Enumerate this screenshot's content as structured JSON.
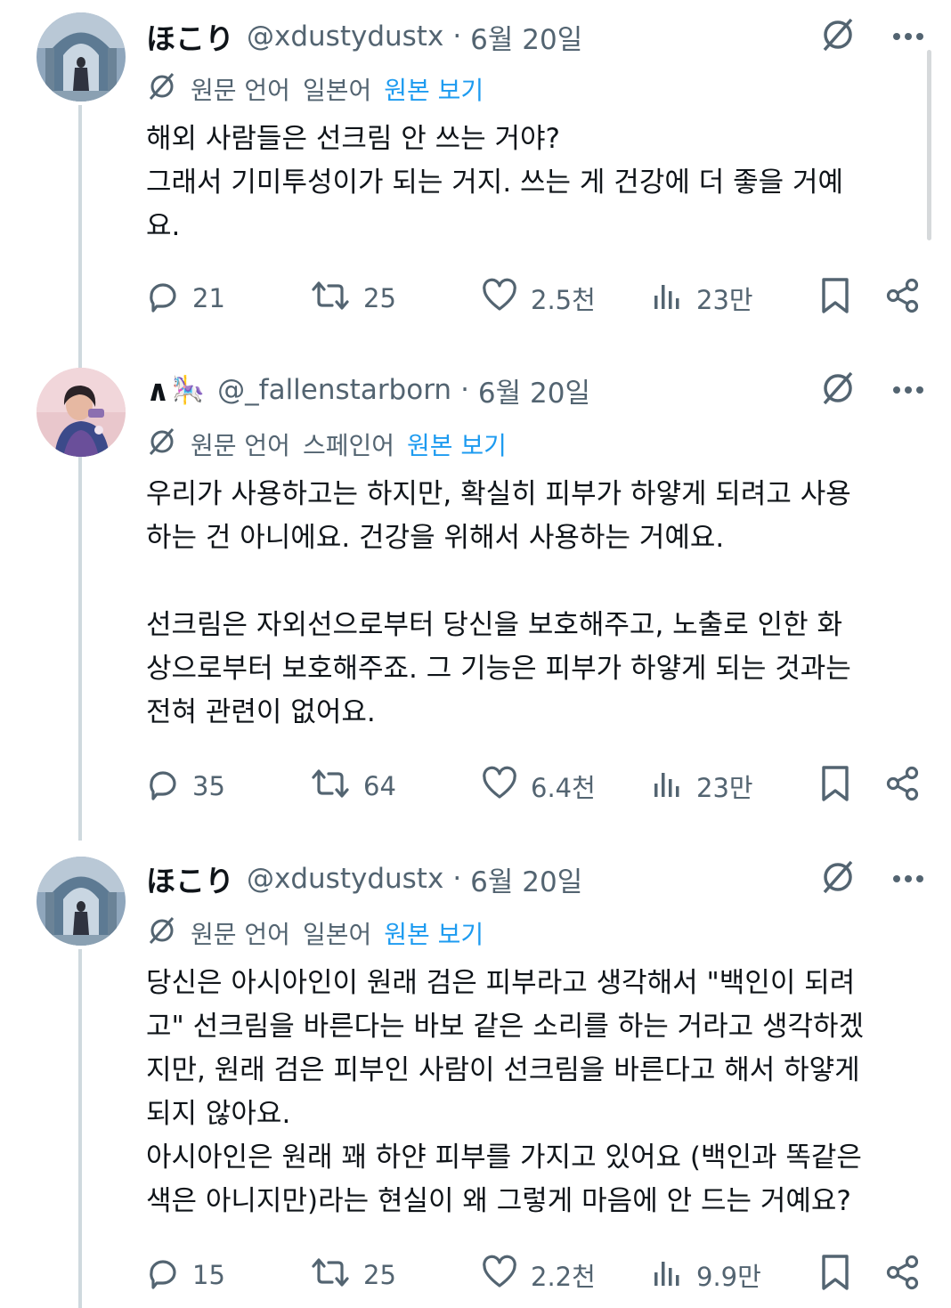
{
  "tweets": [
    {
      "display_name": "ほこり",
      "handle": "@xdustydustx",
      "separator": "·",
      "date": "6월 20일",
      "translated_label": "원문 언어",
      "language": "일본어",
      "show_original": "원본 보기",
      "body": "해외 사람들은 선크림 안 쓰는 거야?\n그래서 기미투성이가 되는 거지. 쓰는 게 건강에 더 좋을 거예\n요.",
      "replies": "21",
      "retweets": "25",
      "likes": "2.5천",
      "views": "23만"
    },
    {
      "display_name": "∧",
      "display_emoji": "🎠",
      "handle": "@_fallenstarborn",
      "separator": "·",
      "date": "6월 20일",
      "translated_label": "원문 언어",
      "language": "스페인어",
      "show_original": "원본 보기",
      "body": "우리가 사용하고는 하지만, 확실히 피부가 하얗게 되려고 사용\n하는 건 아니에요. 건강을 위해서 사용하는 거예요.\n\n선크림은 자외선으로부터 당신을 보호해주고, 노출로 인한 화\n상으로부터 보호해주죠. 그 기능은 피부가 하얗게 되는 것과는\n전혀 관련이 없어요.",
      "replies": "35",
      "retweets": "64",
      "likes": "6.4천",
      "views": "23만"
    },
    {
      "display_name": "ほこり",
      "handle": "@xdustydustx",
      "separator": "·",
      "date": "6월 20일",
      "translated_label": "원문 언어",
      "language": "일본어",
      "show_original": "원본 보기",
      "body": "당신은 아시아인이 원래 검은 피부라고 생각해서 \"백인이 되려\n고\" 선크림을 바른다는 바보 같은 소리를 하는 거라고 생각하겠\n지만, 원래 검은 피부인 사람이 선크림을 바른다고 해서 하얗게\n되지 않아요.\n아시아인은 원래 꽤 하얀 피부를 가지고 있어요 (백인과 똑같은\n색은 아니지만)라는 현실이 왜 그렇게 마음에 안 드는 거예요?",
      "replies": "15",
      "retweets": "25",
      "likes": "2.2천",
      "views": "9.9만"
    }
  ],
  "colors": {
    "text_primary": "#0f1419",
    "text_secondary": "#536471",
    "link": "#1d9bf0",
    "thread_line": "#cfd9de"
  },
  "icons": [
    "translate-icon",
    "more-icon",
    "reply-icon",
    "retweet-icon",
    "like-icon",
    "views-icon",
    "bookmark-icon",
    "share-icon"
  ]
}
